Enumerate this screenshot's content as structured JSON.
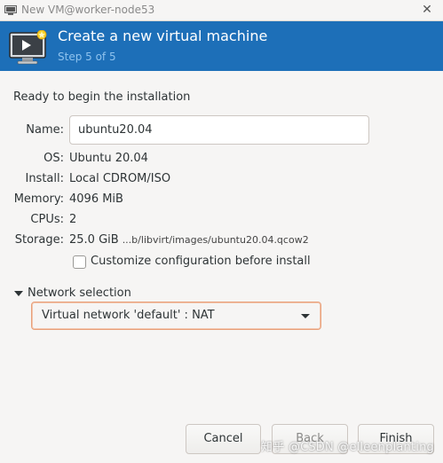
{
  "window": {
    "title": "New VM@worker-node53",
    "close_glyph": "✕"
  },
  "header": {
    "title": "Create a new virtual machine",
    "step": "Step 5 of 5",
    "background_color": "#1d6fb8"
  },
  "summary": {
    "heading": "Ready to begin the installation",
    "name_label": "Name:",
    "name_value": "ubuntu20.04",
    "os_label": "OS:",
    "os_value": "Ubuntu 20.04",
    "install_label": "Install:",
    "install_value": "Local CDROM/ISO",
    "memory_label": "Memory:",
    "memory_value": "4096 MiB",
    "cpus_label": "CPUs:",
    "cpus_value": "2",
    "storage_label": "Storage:",
    "storage_size": "25.0 GiB",
    "storage_path": "...b/libvirt/images/ubuntu20.04.qcow2"
  },
  "customize": {
    "label": "Customize configuration before install",
    "checked": false
  },
  "network": {
    "expander_label": "Network selection",
    "expanded": true,
    "selected": "Virtual network 'default' : NAT"
  },
  "buttons": {
    "cancel": "Cancel",
    "back": "Back",
    "finish": "Finish"
  },
  "watermark": "知乎 @CSDN @elleenplanting"
}
